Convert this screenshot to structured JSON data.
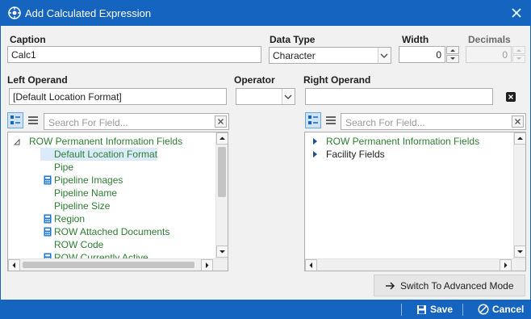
{
  "window": {
    "title": "Add Calculated Expression"
  },
  "form": {
    "caption": {
      "label": "Caption",
      "value": "Calc1"
    },
    "data_type": {
      "label": "Data Type",
      "value": "Character"
    },
    "width": {
      "label": "Width",
      "value": "0"
    },
    "decimals": {
      "label": "Decimals",
      "value": "0"
    },
    "left_operand": {
      "label": "Left Operand",
      "value": "[Default Location Format]"
    },
    "operator": {
      "label": "Operator",
      "value": ""
    },
    "right_operand": {
      "label": "Right Operand",
      "value": ""
    }
  },
  "left_panel": {
    "search_placeholder": "Search For Field...",
    "tree": {
      "root": "ROW Permanent Information Fields",
      "items": [
        {
          "label": "Default Location Format",
          "selected": true,
          "calculated": false
        },
        {
          "label": "Pipe",
          "calculated": false
        },
        {
          "label": "Pipeline Images",
          "calculated": true
        },
        {
          "label": "Pipeline Name",
          "calculated": false
        },
        {
          "label": "Pipeline Size",
          "calculated": false
        },
        {
          "label": "Region",
          "calculated": true
        },
        {
          "label": "ROW Attached Documents",
          "calculated": true
        },
        {
          "label": "ROW Code",
          "calculated": false
        },
        {
          "label": "ROW Currently Active",
          "calculated": true
        }
      ]
    }
  },
  "right_panel": {
    "search_placeholder": "Search For Field...",
    "tree": {
      "items": [
        {
          "label": "ROW Permanent Information Fields",
          "color": "green"
        },
        {
          "label": "Facility Fields",
          "color": "black"
        }
      ]
    }
  },
  "buttons": {
    "advanced": "Switch To Advanced Mode",
    "save": "Save",
    "cancel": "Cancel"
  },
  "colors": {
    "title_bar": "#1565c0",
    "tree_text": "#2e7d32",
    "selection": "#dcebfb"
  }
}
